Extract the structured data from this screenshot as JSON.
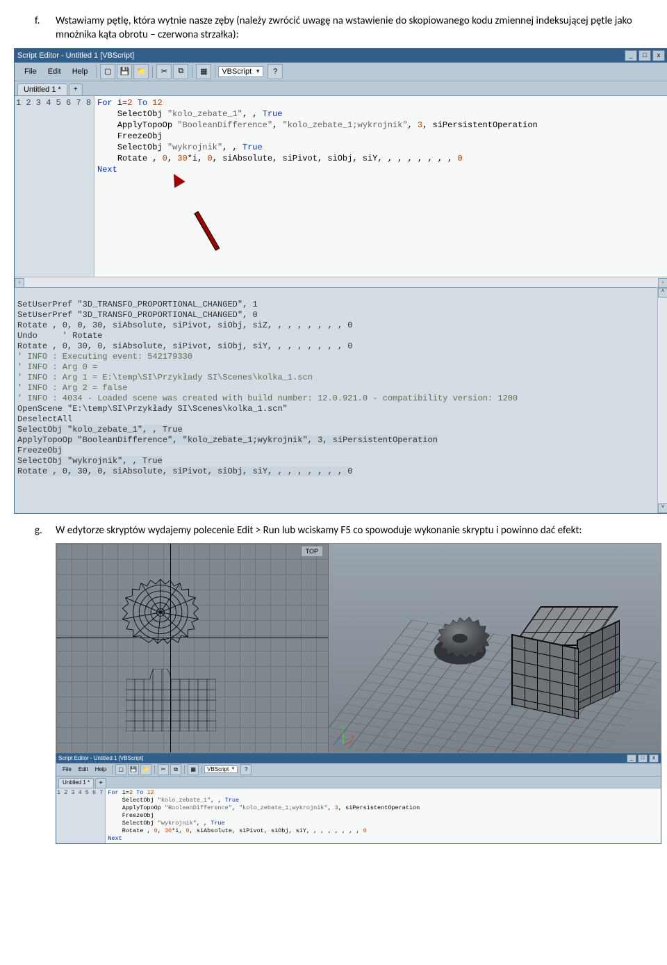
{
  "para_f_marker": "f.",
  "para_f_text": "Wstawiamy pętlę, która wytnie nasze zęby (należy zwrócić uwagę na wstawienie do skopiowanego kodu zmiennej indeksującej pętle jako mnożnika kąta obrotu – czerwona strzałka):",
  "para_g_marker": "g.",
  "para_g_text": "W edytorze skryptów wydajemy polecenie Edit > Run lub wciskamy F5 co spowoduje wykonanie skryptu i powinno dać efekt:",
  "editor": {
    "title": "Script Editor - Untitled 1  [VBScript]",
    "menu": {
      "file": "File",
      "edit": "Edit",
      "help": "Help"
    },
    "language": "VBScript",
    "tab_label": "Untitled 1 *",
    "win_btns": {
      "min": "_",
      "max": "□",
      "close": "x"
    },
    "code_lines": {
      "l1_a": "For",
      "l1_b": " i=",
      "l1_c": "2",
      "l1_d": " To ",
      "l1_e": "12",
      "l2_a": "    SelectObj ",
      "l2_b": "\"kolo_zebate_1\"",
      "l2_c": ", , ",
      "l2_d": "True",
      "l3_a": "    ApplyTopoOp ",
      "l3_b": "\"BooleanDifference\"",
      "l3_c": ", ",
      "l3_d": "\"kolo_zebate_1;wykrojnik\"",
      "l3_e": ", ",
      "l3_f": "3",
      "l3_g": ", siPersistentOperation",
      "l4": "    FreezeObj",
      "l5_a": "    SelectObj ",
      "l5_b": "\"wykrojnik\"",
      "l5_c": ", , ",
      "l5_d": "True",
      "l6_a": "    Rotate , ",
      "l6_b": "0",
      "l6_c": ", ",
      "l6_d": "30",
      "l6_e": "*i, ",
      "l6_f": "0",
      "l6_g": ", siAbsolute, siPivot, siObj, siY, , , , , , , , ",
      "l6_h": "0",
      "l7": "Next"
    },
    "log": {
      "l1": "SetUserPref \"3D_TRANSFO_PROPORTIONAL_CHANGED\", 1",
      "l2": "SetUserPref \"3D_TRANSFO_PROPORTIONAL_CHANGED\", 0",
      "l3": "Rotate , 0, 0, 30, siAbsolute, siPivot, siObj, siZ, , , , , , , , 0",
      "l4": "Undo     ' Rotate",
      "l5": "Rotate , 0, 30, 0, siAbsolute, siPivot, siObj, siY, , , , , , , , 0",
      "l6": "' INFO : Executing event: 542179330",
      "l7": "' INFO : Arg 0 =",
      "l8": "' INFO : Arg 1 = E:\\temp\\SI\\Przykłady SI\\Scenes\\kolka_1.scn",
      "l9": "' INFO : Arg 2 = false",
      "l10": "' INFO : 4034 - Loaded scene was created with build number: 12.0.921.0 - compatibility version: 1200",
      "l11": "OpenScene \"E:\\temp\\SI\\Przykłady SI\\Scenes\\kolka_1.scn\"",
      "l12": "DeselectAll",
      "l13": "SelectObj \"kolo_zebate_1\", , True",
      "l14": "ApplyTopoOp \"BooleanDifference\", \"kolo_zebate_1;wykrojnik\", 3, siPersistentOperation",
      "l15": "FreezeObj",
      "l16": "SelectObj \"wykrojnik\", , True",
      "l17": "Rotate , 0, 30, 0, siAbsolute, siPivot, siObj, siY, , , , , , , , 0"
    }
  },
  "viewport": {
    "top_label": "TOP"
  }
}
